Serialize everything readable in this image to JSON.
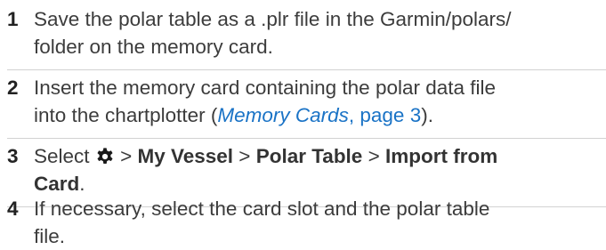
{
  "steps": [
    {
      "number": "1",
      "lines": [
        "Save the polar table as a .plr file in the Garmin/polars/",
        "folder on the memory card."
      ]
    },
    {
      "number": "2",
      "line1": "Insert the memory card containing the polar data file",
      "line2_prefix": "into the chartplotter (",
      "link_title": "Memory Cards",
      "link_page": ", page 3",
      "line2_suffix": ")."
    },
    {
      "number": "3",
      "select_word": "Select",
      "settings_icon": "gear-icon",
      "sep1": " > ",
      "menu1": "My Vessel",
      "sep2": " > ",
      "menu2": "Polar Table",
      "sep3": " > ",
      "menu3": "Import from",
      "menu3_cont": "Card",
      "period": "."
    },
    {
      "number": "4",
      "lines": [
        "If necessary, select the card slot and the polar table",
        "file."
      ]
    }
  ],
  "colors": {
    "text": "#3c3c3c",
    "link": "#1a73c6",
    "divider": "#d2d2d2"
  }
}
